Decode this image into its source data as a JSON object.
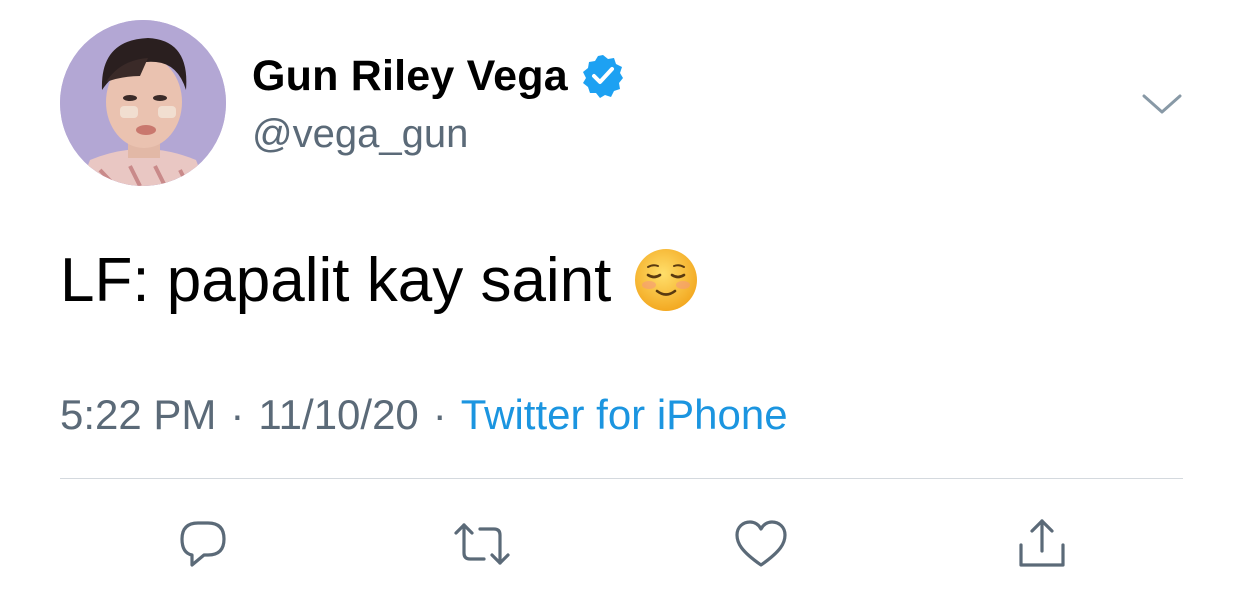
{
  "author": {
    "display_name": "Gun Riley Vega",
    "handle": "@vega_gun",
    "verified": true
  },
  "tweet": {
    "text": "LF: papalit kay saint",
    "emoji": "smiling-face-emoji"
  },
  "meta": {
    "time": "5:22 PM",
    "separator": "·",
    "date": "11/10/20",
    "source": "Twitter for iPhone"
  },
  "actions": {
    "icons": [
      "reply-icon",
      "retweet-icon",
      "like-icon",
      "share-icon"
    ]
  },
  "colors": {
    "text": "#000000",
    "secondary": "#5b6a78",
    "link": "#1b95e0",
    "verified": "#1da1f2",
    "icon": "#5b6a78"
  }
}
